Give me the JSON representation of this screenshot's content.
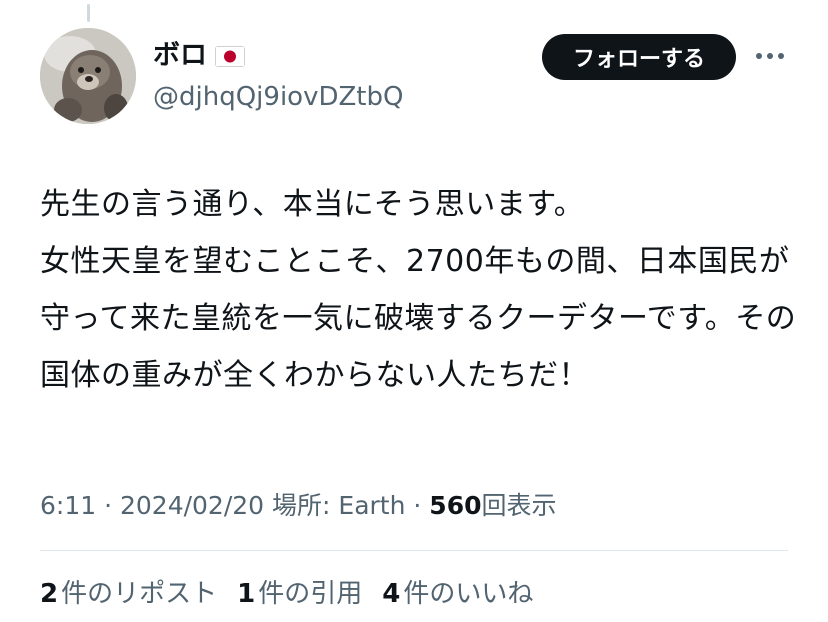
{
  "post": {
    "author": {
      "display_name": "ボロ",
      "flag_icon": "japan-flag-icon",
      "handle": "@djhqQj9iovDZtbQ"
    },
    "follow_label": "フォローする",
    "more_icon": "more-horizontal-icon",
    "text": "先生の言う通り、本当にそう思います。\n女性天皇を望むことこそ、2700年もの間、日本国民が守って来た皇統を一気に破壊するクーデターです。その国体の重みが全くわからない人たちだ！",
    "meta": {
      "time": "6:11",
      "sep1": " · ",
      "date": "2024/02/20",
      "location_label": " 場所: ",
      "location": "Earth",
      "sep2": " · ",
      "views_count": "560",
      "views_label": "回表示"
    },
    "stats": {
      "reposts_count": "2",
      "reposts_label": "件のリポスト",
      "quotes_count": "1",
      "quotes_label": "件の引用",
      "likes_count": "4",
      "likes_label": "件のいいね"
    }
  },
  "colors": {
    "text_primary": "#0f1419",
    "text_secondary": "#536471",
    "follow_bg": "#0f1419",
    "divider": "#e1e6ea",
    "flag_red": "#bc002d"
  }
}
